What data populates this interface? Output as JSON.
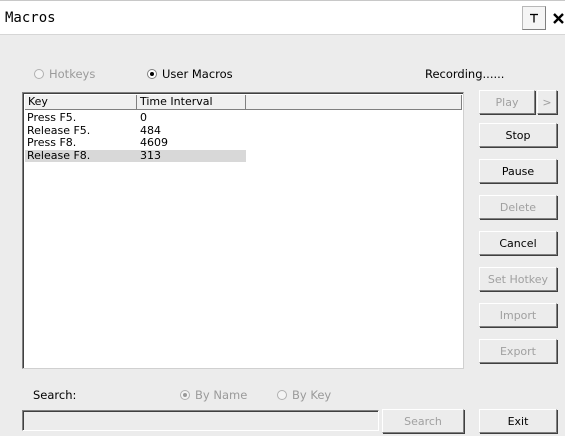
{
  "window": {
    "title": "Macros",
    "pin_label": "T",
    "close_label": "✕"
  },
  "mode": {
    "hotkeys_label": "Hotkeys",
    "user_macros_label": "User Macros",
    "selected": "User Macros"
  },
  "status_text": "Recording......",
  "list": {
    "columns": [
      "Key",
      "Time Interval"
    ],
    "rows": [
      {
        "key": "Press F5.",
        "interval": "0"
      },
      {
        "key": "Release F5.",
        "interval": "484"
      },
      {
        "key": "Press F8.",
        "interval": "4609"
      },
      {
        "key": "Release F8.",
        "interval": "313"
      }
    ],
    "selected_row": 3
  },
  "buttons": {
    "play": "Play",
    "play_next": ">",
    "stop": "Stop",
    "pause": "Pause",
    "delete": "Delete",
    "cancel": "Cancel",
    "set_hotkey": "Set Hotkey",
    "import": "Import",
    "export": "Export",
    "search": "Search",
    "exit": "Exit"
  },
  "search": {
    "label": "Search:",
    "by_name_label": "By Name",
    "by_key_label": "By Key",
    "selected": "By Name",
    "value": ""
  },
  "colors": {
    "window_bg": "#ececec",
    "selection_bg": "#d8d8d8",
    "disabled_text": "#a0a0a0"
  }
}
